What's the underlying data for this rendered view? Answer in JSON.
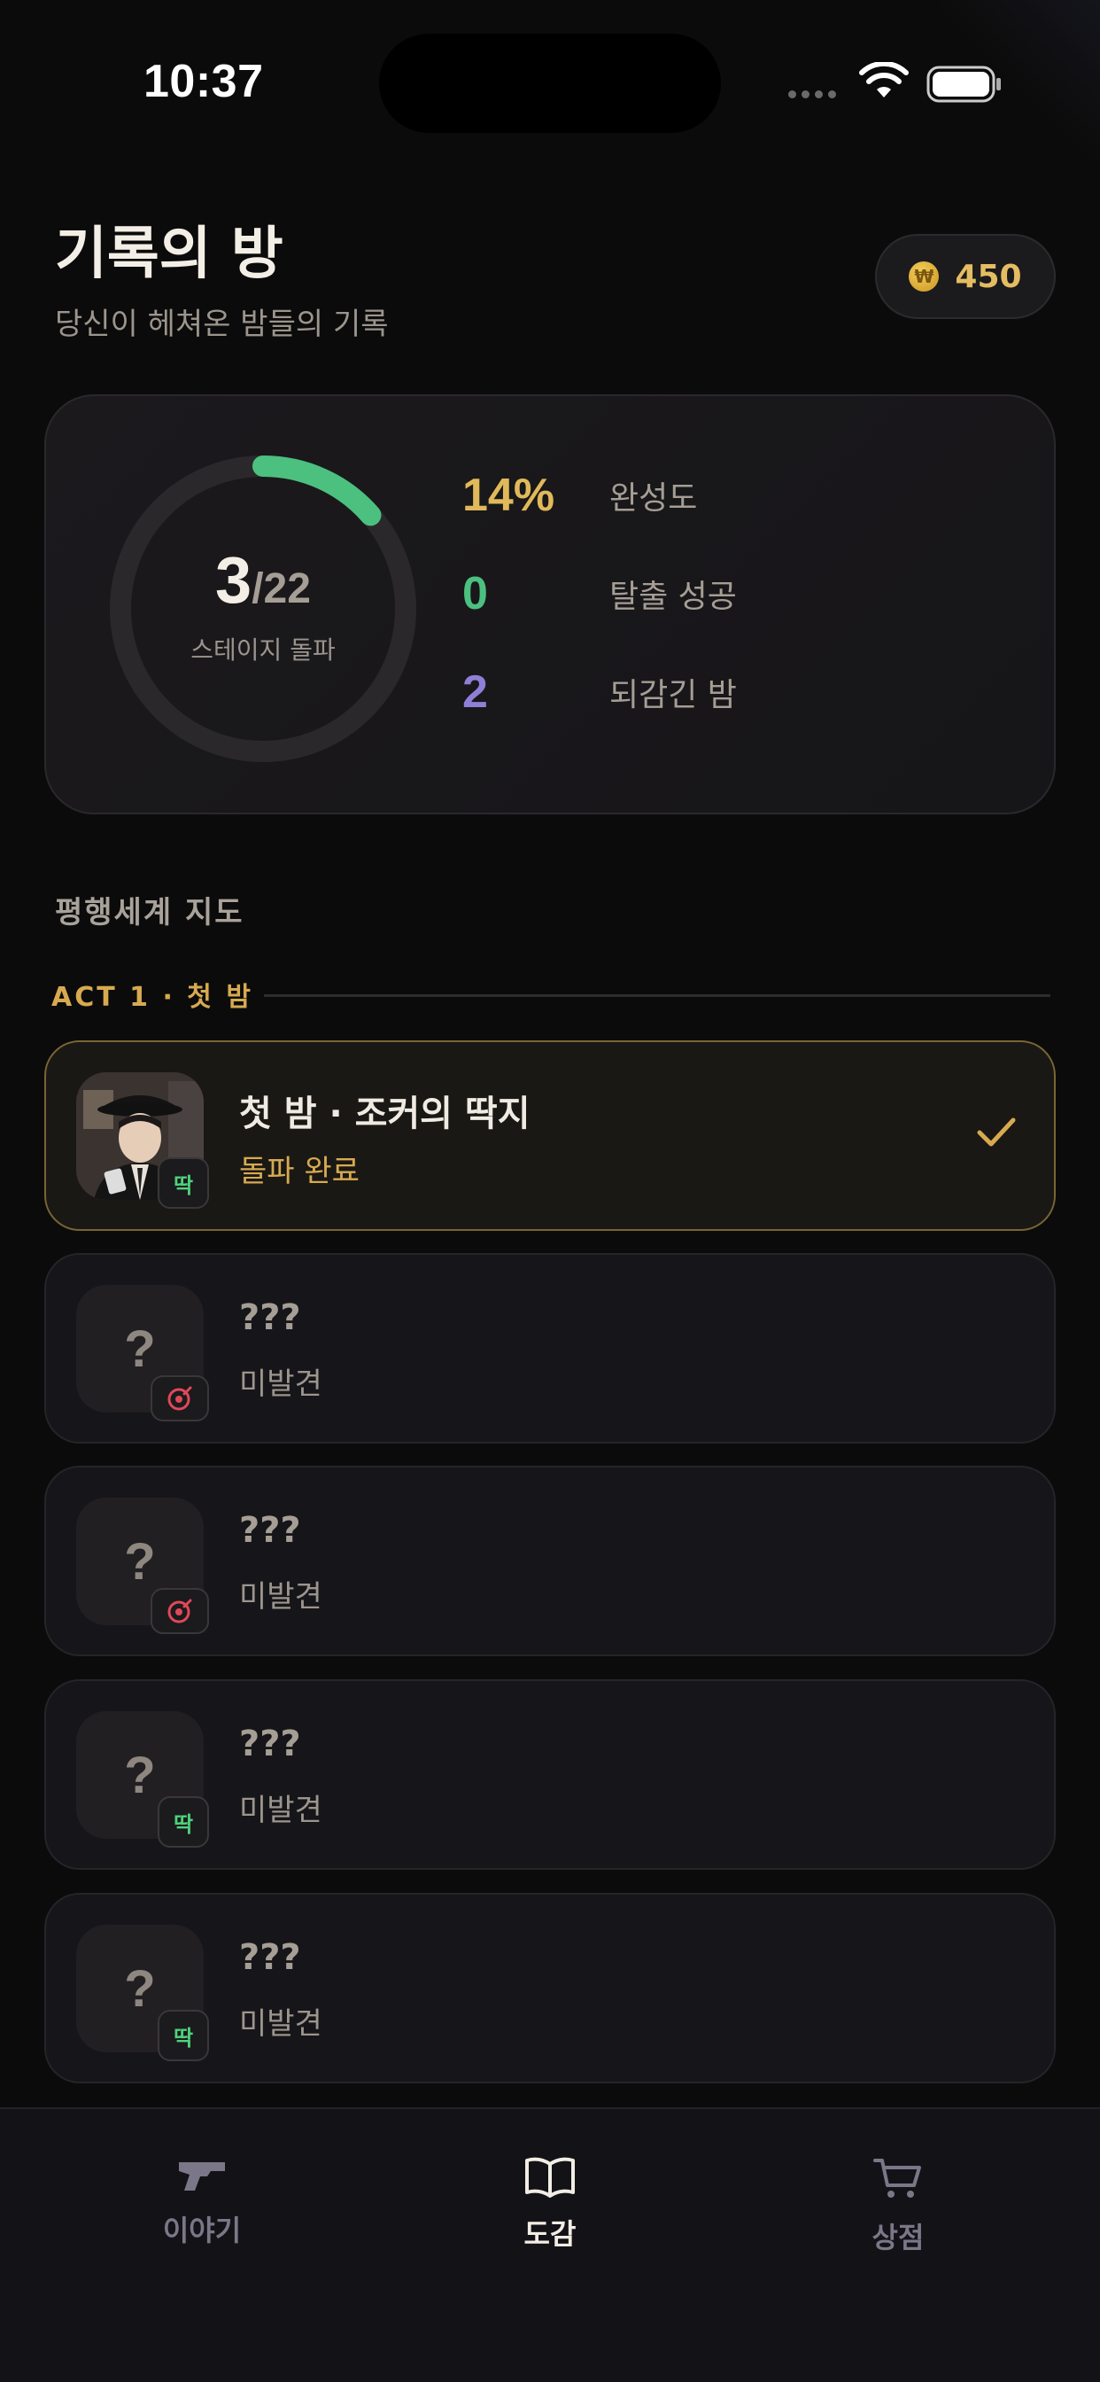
{
  "status_bar": {
    "time": "10:37"
  },
  "header": {
    "title": "기록의 방",
    "subtitle": "당신이 헤쳐온 밤들의 기록",
    "coins": "450"
  },
  "progress": {
    "current": "3",
    "total": "/22",
    "label": "스테이지 돌파",
    "fraction": 0.136,
    "stats": [
      {
        "value": "14%",
        "label": "완성도",
        "color": "#e0b95a"
      },
      {
        "value": "0",
        "label": "탈출 성공",
        "color": "#4cc07f"
      },
      {
        "value": "2",
        "label": "되감긴 밤",
        "color": "#8f7fd6"
      }
    ]
  },
  "map": {
    "section_title": "평행세계 지도",
    "act_label": "ACT 1 · 첫 밤",
    "stages": [
      {
        "title": "첫 밤 · 조커의 딱지",
        "status": "돌파 완료",
        "badge": "딱",
        "badge_type": "ttak",
        "cleared": true
      },
      {
        "title": "???",
        "status": "미발견",
        "badge": "target-icon",
        "badge_type": "target",
        "cleared": false
      },
      {
        "title": "???",
        "status": "미발견",
        "badge": "target-icon",
        "badge_type": "target",
        "cleared": false
      },
      {
        "title": "???",
        "status": "미발견",
        "badge": "딱",
        "badge_type": "ttak",
        "cleared": false
      },
      {
        "title": "???",
        "status": "미발견",
        "badge": "딱",
        "badge_type": "ttak",
        "cleared": false
      }
    ],
    "locked_symbol": "?"
  },
  "nav": {
    "items": [
      {
        "label": "이야기",
        "icon": "gun-icon",
        "active": false
      },
      {
        "label": "도감",
        "icon": "book-icon",
        "active": true
      },
      {
        "label": "상점",
        "icon": "cart-icon",
        "active": false
      }
    ]
  },
  "colors": {
    "accent_gold": "#d7aa50",
    "ring_green": "#4cc07f",
    "background": "#0c0b0b"
  }
}
